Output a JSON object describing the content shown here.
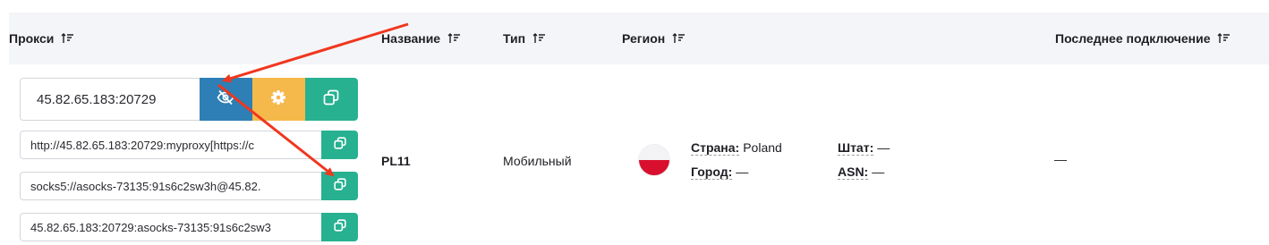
{
  "columns": {
    "proxy": "Прокси",
    "name": "Название",
    "type": "Тип",
    "region": "Регион",
    "last_connection": "Последнее подключение"
  },
  "row": {
    "proxy_address": "45.82.65.183:20729",
    "http_string": "http://45.82.65.183:20729:myproxy[https://c",
    "socks_string": "socks5://asocks-73135:91s6c2sw3h@45.82.",
    "plain_string": "45.82.65.183:20729:asocks-73135:91s6c2sw3",
    "name": "PL11",
    "type": "Мобильный",
    "region": {
      "country_label": "Страна:",
      "country_value": "Poland",
      "city_label": "Город:",
      "city_value": "—",
      "state_label": "Штат:",
      "state_value": "—",
      "asn_label": "ASN:",
      "asn_value": "—"
    },
    "last_connection": "—"
  },
  "icons": {
    "sort": "sort-icon",
    "eye_off": "eye-off-icon",
    "gear": "gear-icon",
    "copy": "copy-icon",
    "flag": "poland-flag-icon"
  },
  "colors": {
    "header_bg": "#f4f5f8",
    "eye_button": "#2d7fb5",
    "settings_button": "#f5b84a",
    "copy_button": "#27b191",
    "annotation_arrow": "#f0361e"
  }
}
